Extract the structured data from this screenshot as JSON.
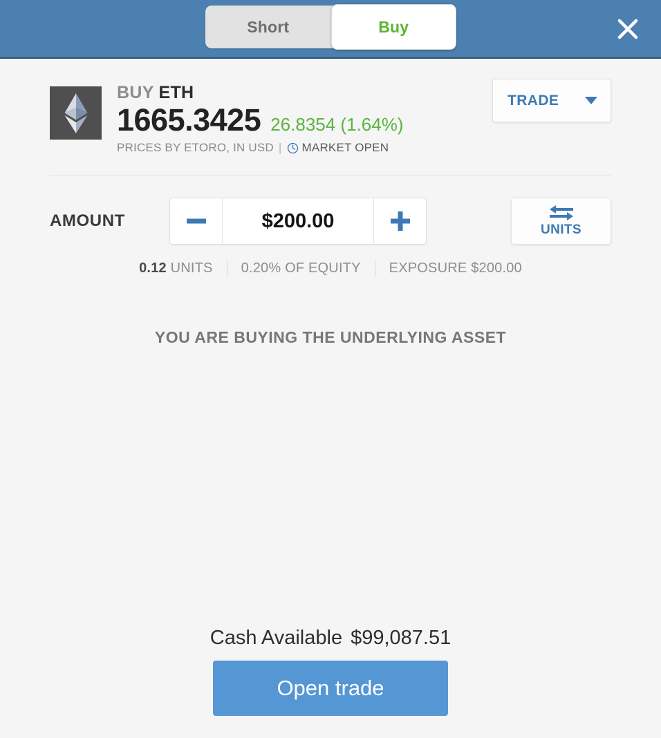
{
  "header": {
    "toggle": {
      "options": [
        {
          "label": "Short",
          "active": false
        },
        {
          "label": "Buy",
          "active": true
        }
      ]
    },
    "close_icon": "close-icon",
    "background_color": "#4b80b1",
    "active_color": "#5cb531"
  },
  "asset": {
    "logo_icon": "ethereum-logo-icon",
    "direction": "BUY ",
    "symbol": "ETH",
    "price": "1665.3425",
    "change": "26.8354 (1.64%)",
    "change_color": "#5cb340",
    "prices_by": "PRICES BY ETORO, IN USD",
    "separator": "|",
    "market_status": "MARKET OPEN",
    "clock_icon": "clock-icon"
  },
  "trade_select": {
    "label": "TRADE",
    "chevron_icon": "chevron-down-icon",
    "accent_color": "#3d7ab4"
  },
  "amount": {
    "label": "AMOUNT",
    "value": "$200.00",
    "minus_icon": "minus-icon",
    "plus_icon": "plus-icon",
    "units_button": {
      "label": "UNITS",
      "swap_icon": "swap-arrows-icon"
    }
  },
  "stats": {
    "units_value": "0.12",
    "units_label": " UNITS",
    "equity": "0.20% OF EQUITY",
    "exposure": "EXPOSURE $200.00"
  },
  "notice": {
    "text": "YOU ARE BUYING THE UNDERLYING ASSET"
  },
  "footer": {
    "cash_label": "Cash Available",
    "cash_amount": "$99,087.51",
    "open_trade_label": "Open trade",
    "button_color": "#5596d4"
  }
}
